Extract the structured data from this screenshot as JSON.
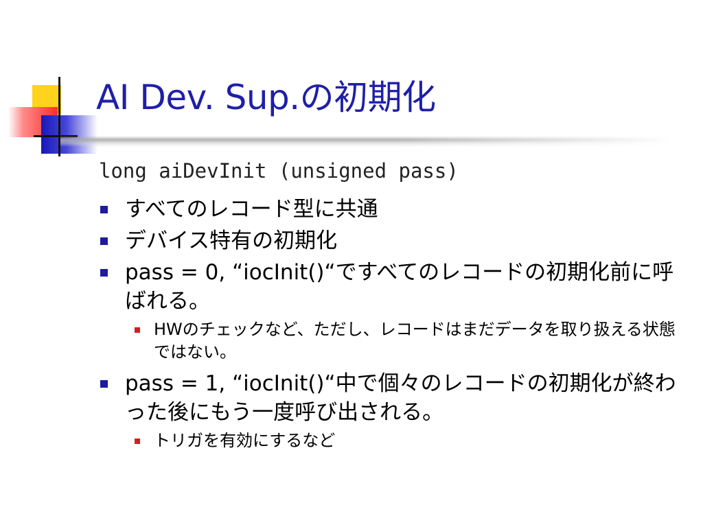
{
  "slide": {
    "title": "AI Dev. Sup.の初期化",
    "code": "long aiDevInit (unsigned pass)",
    "bullets": [
      {
        "text": "すべてのレコード型に共通"
      },
      {
        "text": "デバイス特有の初期化"
      },
      {
        "text": "pass = 0, “iocInit()“ですべてのレコードの初期化前に呼ばれる。",
        "sub": "HWのチェックなど、ただし、レコードはまだデータを取り扱える状態ではない。"
      },
      {
        "text": "pass = 1, “iocInit()“中で個々のレコードの初期化が終わった後にもう一度呼び出される。",
        "sub": "トリガを有効にするなど"
      }
    ]
  },
  "colors": {
    "title": "#1f1fa8",
    "bullet_level1": "#1c1c9c",
    "bullet_level2": "#d41e1e",
    "logo_yellow": "#ffd21c",
    "logo_red": "#ff2c2c",
    "logo_blue": "#1818b8"
  }
}
